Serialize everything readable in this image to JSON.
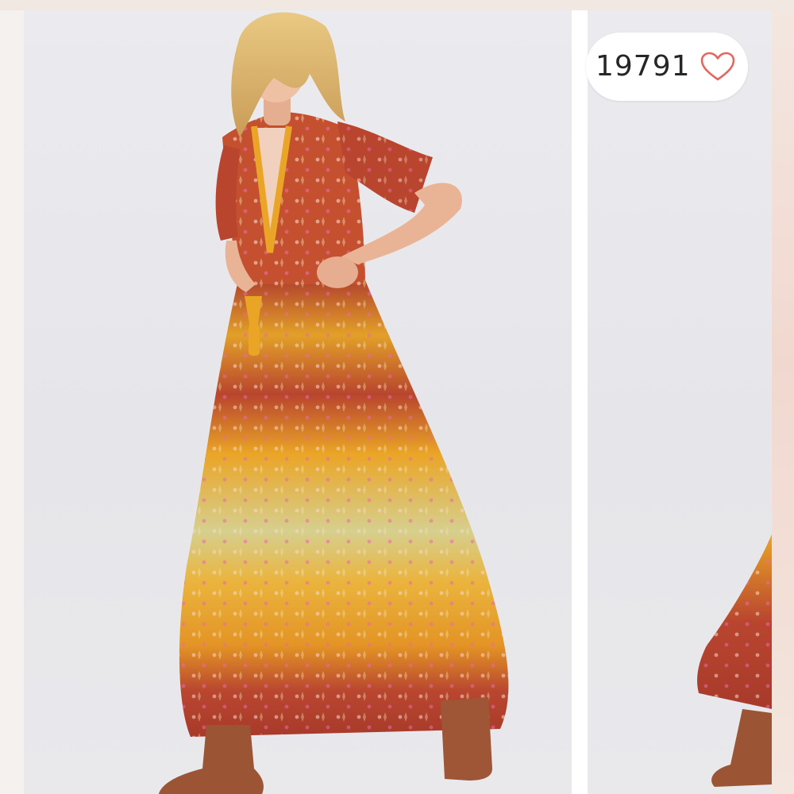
{
  "like_widget": {
    "count": "19791",
    "icon": "heart-outline-icon",
    "heart_color": "#e2675f"
  },
  "photos": [
    {
      "subject": "model-in-printed-maxi-dress",
      "dress_colors": [
        "#b3442c",
        "#e9a424",
        "#f3c84b",
        "#d7cf86"
      ]
    },
    {
      "subject": "next-photo-partial"
    }
  ]
}
